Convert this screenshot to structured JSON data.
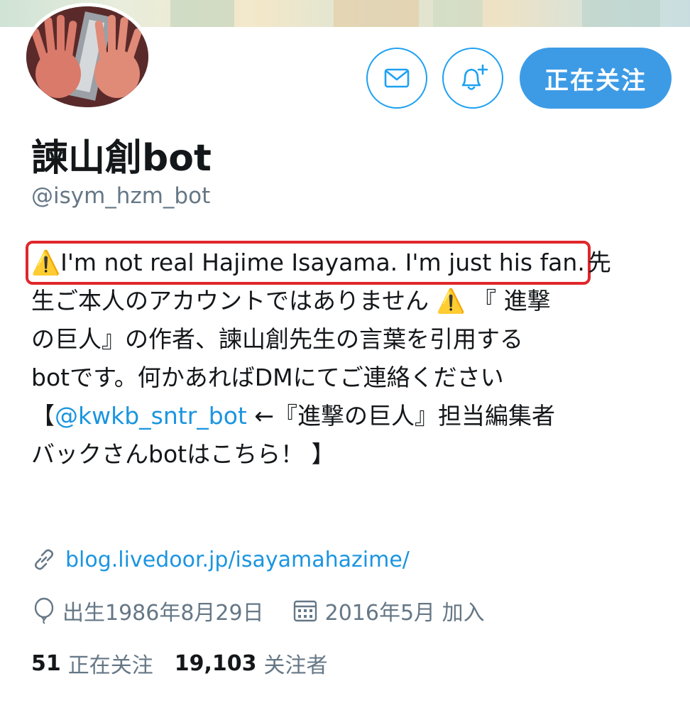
{
  "profile": {
    "name": "諫山創bot",
    "handle": "@isym_hzm_bot"
  },
  "actions": {
    "message_icon": "envelope-icon",
    "notify_icon": "bell-plus-icon",
    "follow_label": "正在关注"
  },
  "bio": {
    "highlighted": "I'm not real Hajime Isayama. I'm just his fan.",
    "line1_tail": "先",
    "line2": "生ご本人のアカウントではありません",
    "line2_tail": "『 進撃",
    "line3": "の巨人』の作者、諫山創先生の言葉を引用する",
    "line4": "botです。何かあればDMにてご連絡ください",
    "line5_open": "【",
    "mention": "@kwkb_sntr_bot",
    "line5_tail": " ←『進撃の巨人』担当編集者",
    "line6": "バックさんbotはこちら！ 】",
    "warning_glyph": "⚠️"
  },
  "meta": {
    "website": "blog.livedoor.jp/isayamahazime/",
    "birthday": "出生1986年8月29日",
    "joined": "2016年5月 加入"
  },
  "stats": {
    "following_count": "51",
    "following_label": "正在关注",
    "followers_count": "19,103",
    "followers_label": "关注者"
  },
  "colors": {
    "accent": "#1da1f2",
    "follow_button": "#3d9be6",
    "highlight_box": "#e0262b",
    "secondary_text": "#657786"
  }
}
